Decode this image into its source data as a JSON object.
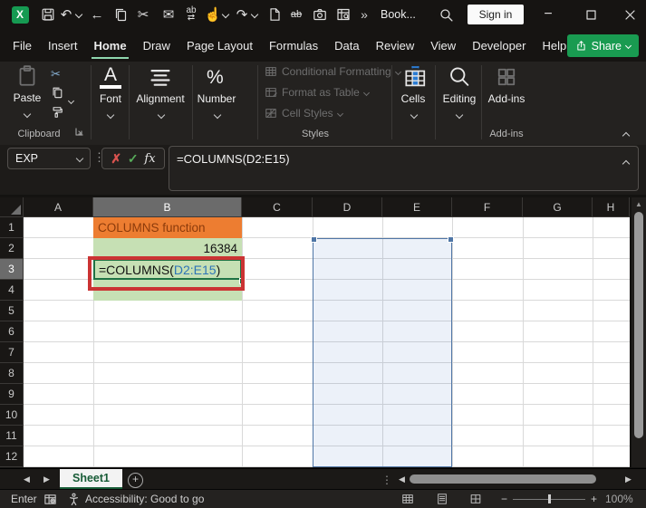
{
  "window": {
    "title": "Book...",
    "sign_in": "Sign in"
  },
  "menu": {
    "items": [
      "File",
      "Insert",
      "Home",
      "Draw",
      "Page Layout",
      "Formulas",
      "Data",
      "Review",
      "View",
      "Developer",
      "Help"
    ],
    "share": "Share"
  },
  "ribbon": {
    "paste": "Paste",
    "clipboard_group": "Clipboard",
    "font_group": "Font",
    "alignment_group": "Alignment",
    "number_group": "Number",
    "conditional_formatting": "Conditional Formatting",
    "format_as_table": "Format as Table",
    "cell_styles": "Cell Styles",
    "styles_group": "Styles",
    "cells": "Cells",
    "editing": "Editing",
    "addins": "Add-ins",
    "addins_group": "Add-ins"
  },
  "formula_bar": {
    "name_box": "EXP",
    "fx": "fx",
    "formula": "=COLUMNS(D2:E15)"
  },
  "grid": {
    "columns": [
      "A",
      "B",
      "C",
      "D",
      "E",
      "F",
      "G",
      "H"
    ],
    "rows": [
      "1",
      "2",
      "3",
      "4",
      "5",
      "6",
      "7",
      "8",
      "9",
      "10",
      "11",
      "12"
    ],
    "b1": "COLUMNS function",
    "b2": "16384",
    "b3_prefix": "=COLUMNS(",
    "b3_ref": "D2:E15",
    "b3_suffix": ")"
  },
  "tabs": {
    "sheet1": "Sheet1"
  },
  "status": {
    "mode": "Enter",
    "accessibility": "Accessibility: Good to go",
    "zoom": "100%"
  },
  "icons": {
    "excel_logo": "X",
    "undo": "↶",
    "redo": "↷",
    "back": "←",
    "cut": "✂",
    "mail": "✉",
    "touch": "☝",
    "ab": "ab",
    "swap": "⇄",
    "more": "»",
    "percent": "%",
    "font_a": "A",
    "dots": "⋮",
    "cancel": "✗",
    "check": "✓",
    "up_arrow": "▲",
    "left_arrow": "◀",
    "right_arrow": "▶",
    "minus": "−",
    "plus": "+"
  }
}
